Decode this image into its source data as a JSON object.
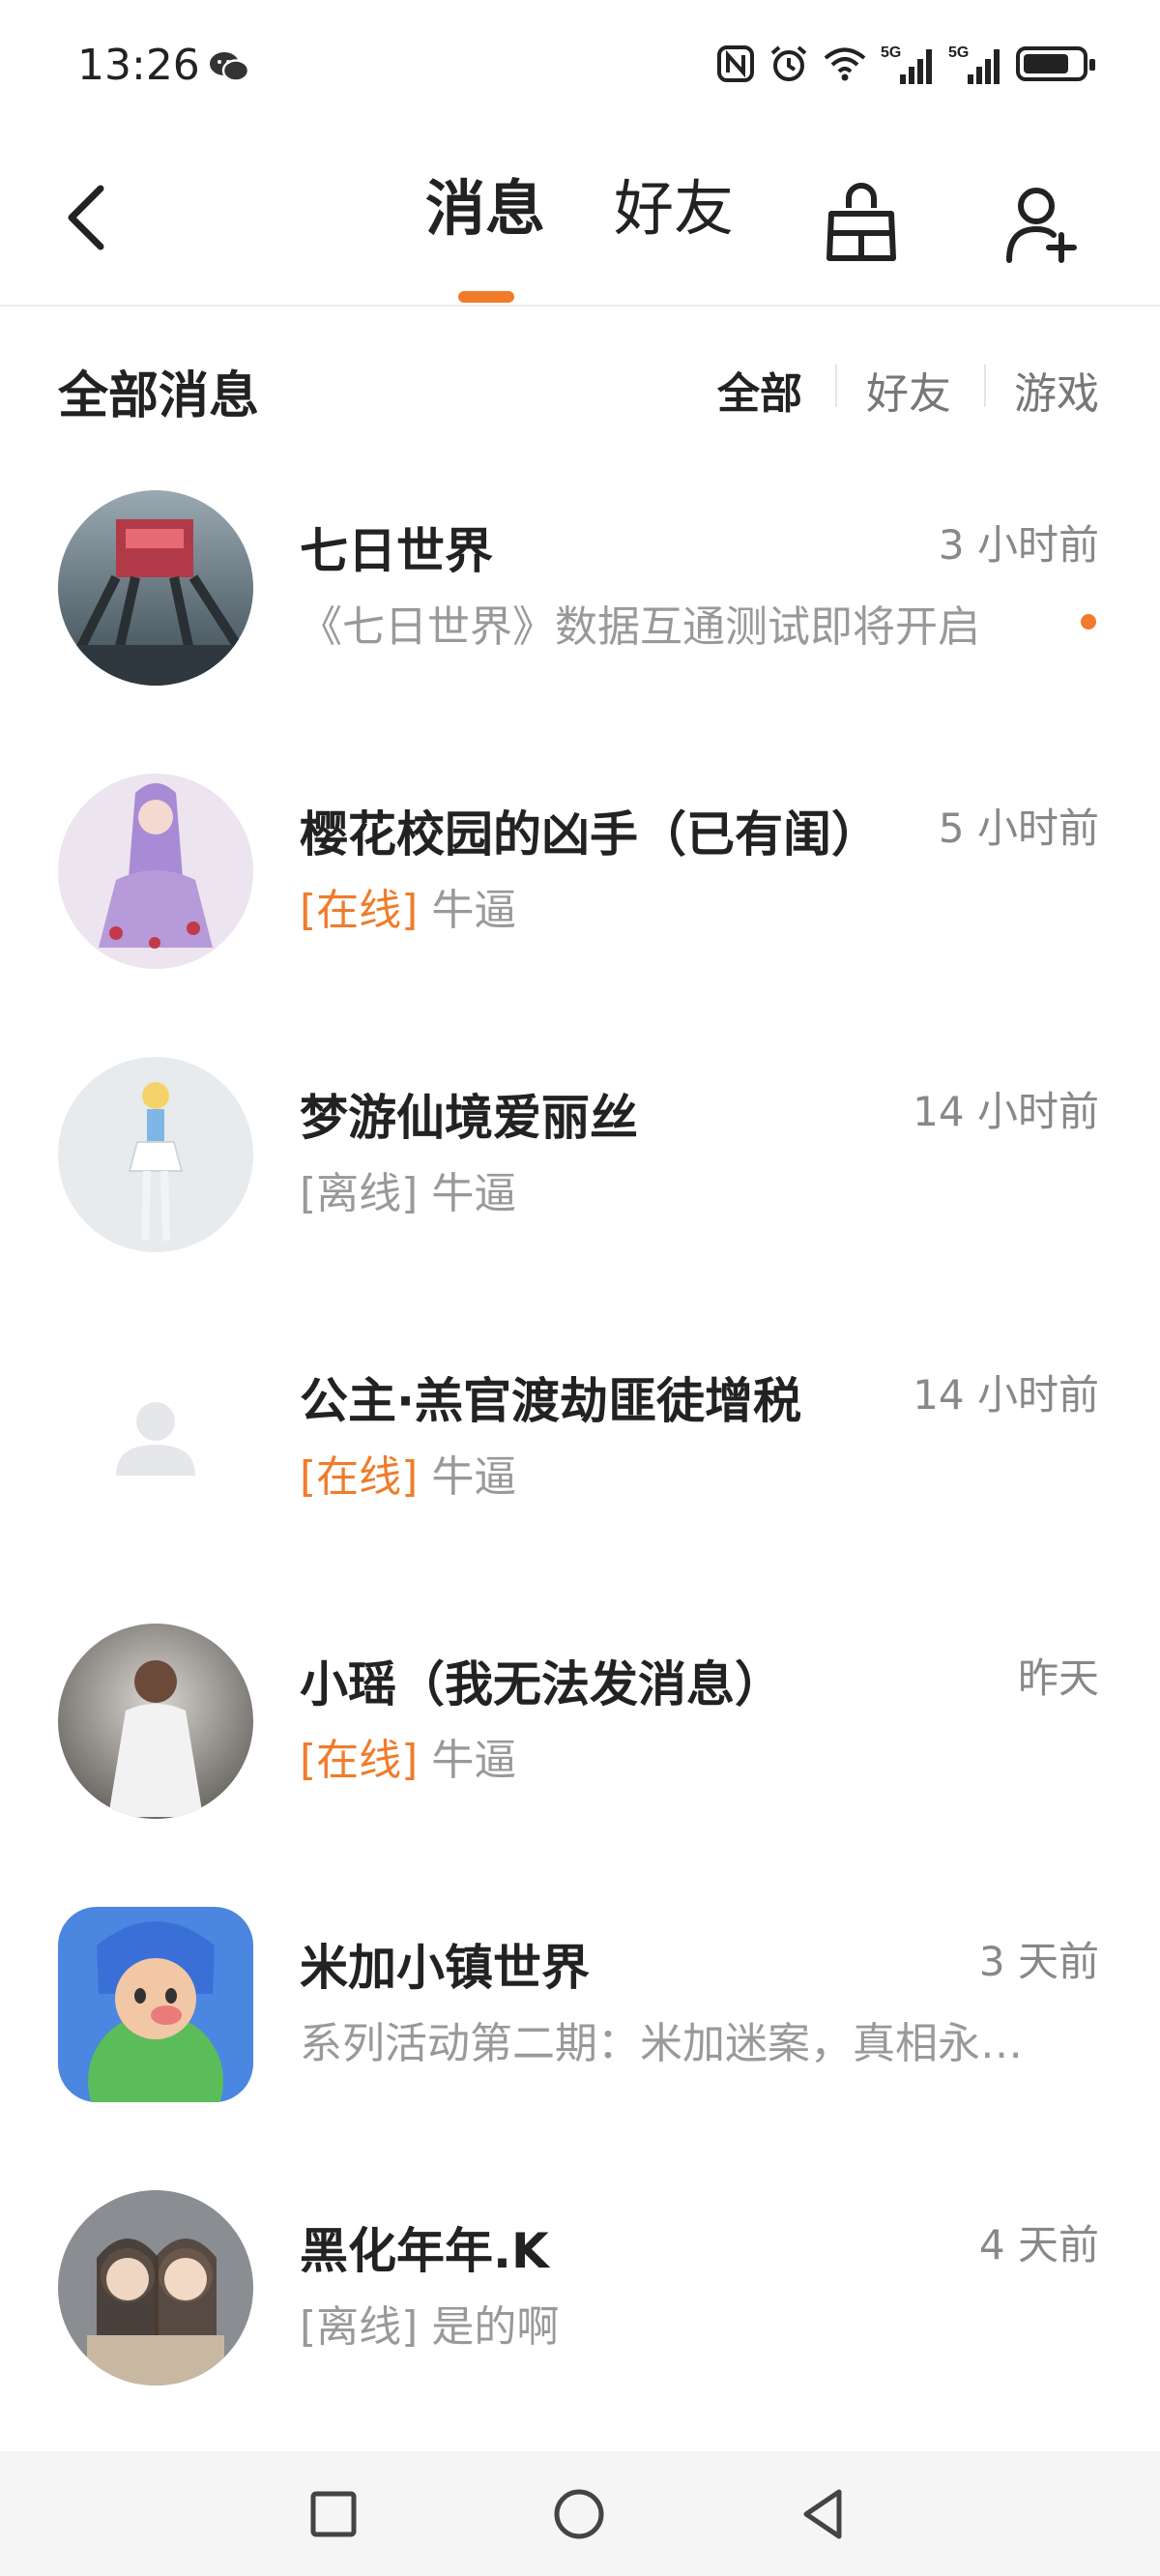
{
  "status_bar": {
    "time": "13:26",
    "signal_1": "5G",
    "signal_2": "5G",
    "icons": [
      "wechat-icon",
      "nfc-icon",
      "alarm-icon",
      "wifi-icon",
      "signal-icon",
      "signal-icon",
      "battery-icon"
    ]
  },
  "header": {
    "tabs": [
      {
        "label": "消息",
        "active": true
      },
      {
        "label": "好友",
        "active": false
      }
    ],
    "accent_color": "#f07c2b"
  },
  "filter": {
    "title": "全部消息",
    "options": [
      {
        "label": "全部",
        "active": true
      },
      {
        "label": "好友",
        "active": false
      },
      {
        "label": "游戏",
        "active": false
      }
    ]
  },
  "messages": [
    {
      "name": "七日世界",
      "time": "3 小时前",
      "status": "",
      "preview": "《七日世界》数据互通测试即将开启",
      "unread": true
    },
    {
      "name": "樱花校园的凶手（已有闺）",
      "time": "5 小时前",
      "status": "[在线]",
      "status_type": "online",
      "preview": "牛逼"
    },
    {
      "name": "梦游仙境爱丽丝",
      "time": "14 小时前",
      "status": "[离线]",
      "status_type": "offline",
      "preview": "牛逼"
    },
    {
      "name": "公主·羔官渡劫匪徒增税",
      "time": "14 小时前",
      "status": "[在线]",
      "status_type": "online",
      "preview": "牛逼"
    },
    {
      "name": "小瑶（我无法发消息）",
      "time": "昨天",
      "status": "[在线]",
      "status_type": "online",
      "preview": "牛逼"
    },
    {
      "name": "米加小镇世界",
      "time": "3 天前",
      "status": "",
      "preview": "系列活动第二期：米加迷案，真相永…"
    },
    {
      "name": "黑化年年.K",
      "time": "4 天前",
      "status": "[离线]",
      "status_type": "offline",
      "preview": "是的啊"
    }
  ]
}
